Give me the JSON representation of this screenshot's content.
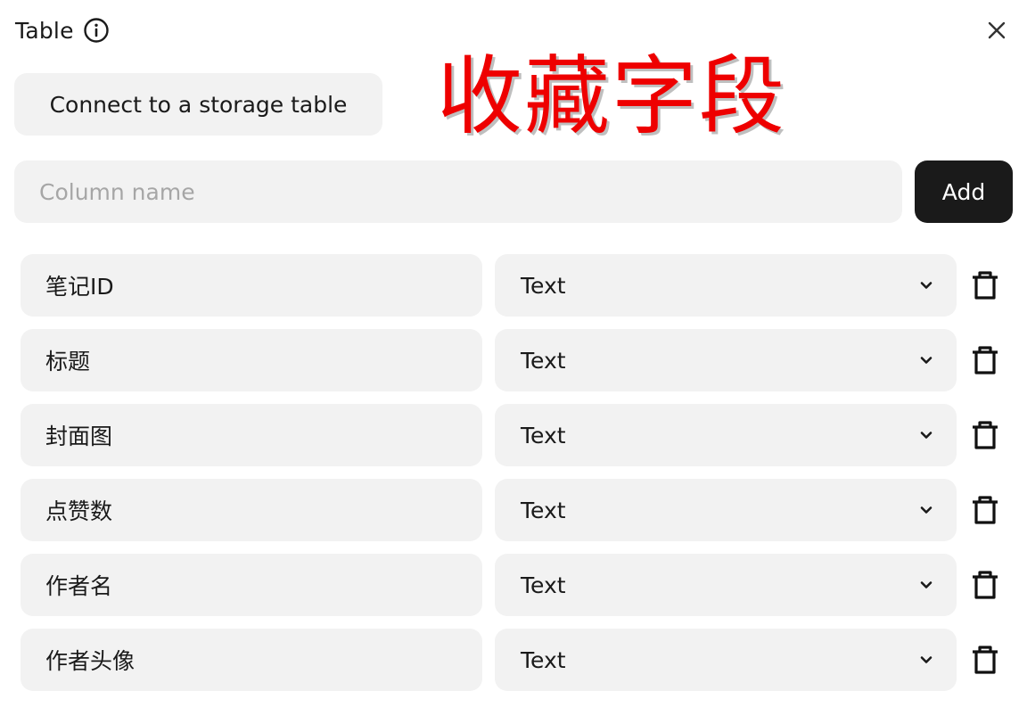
{
  "header": {
    "title": "Table",
    "info_icon": "info-circle-icon",
    "close_icon": "close-icon"
  },
  "connect_button": {
    "label": "Connect to a storage table"
  },
  "overlay": {
    "text": "收藏字段",
    "color": "#ee0000"
  },
  "column_input": {
    "value": "",
    "placeholder": "Column name"
  },
  "add_button": {
    "label": "Add"
  },
  "fields": [
    {
      "name": "笔记ID",
      "type": "Text"
    },
    {
      "name": "标题",
      "type": "Text"
    },
    {
      "name": "封面图",
      "type": "Text"
    },
    {
      "name": "点赞数",
      "type": "Text"
    },
    {
      "name": "作者名",
      "type": "Text"
    },
    {
      "name": "作者头像",
      "type": "Text"
    }
  ],
  "icons": {
    "select": "chevron-down-icon",
    "delete": "trash-icon"
  }
}
